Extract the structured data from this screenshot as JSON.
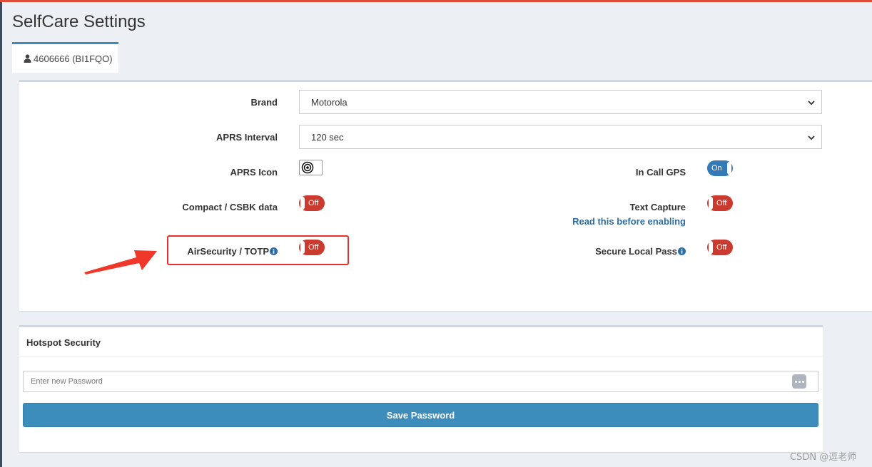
{
  "page": {
    "title": "SelfCare Settings"
  },
  "tab": {
    "label": "4606666 (BI1FQO)",
    "icon": "user-icon"
  },
  "settings": {
    "brand": {
      "label": "Brand",
      "value": "Motorola"
    },
    "aprs_interval": {
      "label": "APRS Interval",
      "value": "120 sec"
    },
    "aprs_icon": {
      "label": "APRS Icon",
      "icon": "target-icon"
    },
    "in_call_gps": {
      "label": "In Call GPS",
      "state": "On"
    },
    "compact_csbk": {
      "label": "Compact / CSBK data",
      "state": "Off"
    },
    "text_capture": {
      "label": "Text Capture",
      "state": "Off",
      "link": "Read this before enabling"
    },
    "air_security": {
      "label": "AirSecurity / TOTP",
      "state": "Off",
      "icon": "info-icon"
    },
    "secure_local_pass": {
      "label": "Secure Local Pass",
      "state": "Off",
      "icon": "info-icon"
    }
  },
  "hotspot": {
    "title": "Hotspot Security",
    "password_placeholder": "Enter new Password",
    "save_label": "Save Password"
  },
  "watermark": "CSDN @逗老师",
  "colors": {
    "toggle_off": "#cb3a2f",
    "toggle_on": "#337ab7",
    "primary_button": "#3c8dbc",
    "annotation_red": "#e8312c",
    "link": "#2e6da4"
  }
}
